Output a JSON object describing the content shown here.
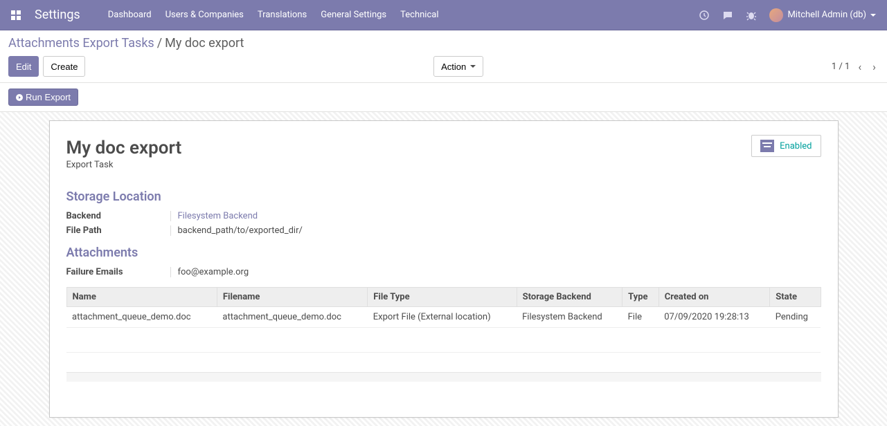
{
  "navbar": {
    "title": "Settings",
    "links": [
      "Dashboard",
      "Users & Companies",
      "Translations",
      "General Settings",
      "Technical"
    ],
    "user": "Mitchell Admin (db)"
  },
  "breadcrumb": {
    "parent": "Attachments Export Tasks",
    "current": "My doc export"
  },
  "buttons": {
    "edit": "Edit",
    "create": "Create",
    "action": "Action",
    "run_export": "Run Export"
  },
  "pager": {
    "text": "1 / 1"
  },
  "record": {
    "title": "My doc export",
    "subtitle": "Export Task",
    "status": "Enabled"
  },
  "sections": {
    "storage": "Storage Location",
    "attachments": "Attachments"
  },
  "fields": {
    "backend_label": "Backend",
    "backend_value": "Filesystem Backend",
    "filepath_label": "File Path",
    "filepath_value": "backend_path/to/exported_dir/",
    "failure_emails_label": "Failure Emails",
    "failure_emails_value": "foo@example.org"
  },
  "table": {
    "headers": [
      "Name",
      "Filename",
      "File Type",
      "Storage Backend",
      "Type",
      "Created on",
      "State"
    ],
    "rows": [
      {
        "name": "attachment_queue_demo.doc",
        "filename": "attachment_queue_demo.doc",
        "file_type": "Export File (External location)",
        "storage_backend": "Filesystem Backend",
        "type": "File",
        "created_on": "07/09/2020 19:28:13",
        "state": "Pending"
      }
    ]
  }
}
